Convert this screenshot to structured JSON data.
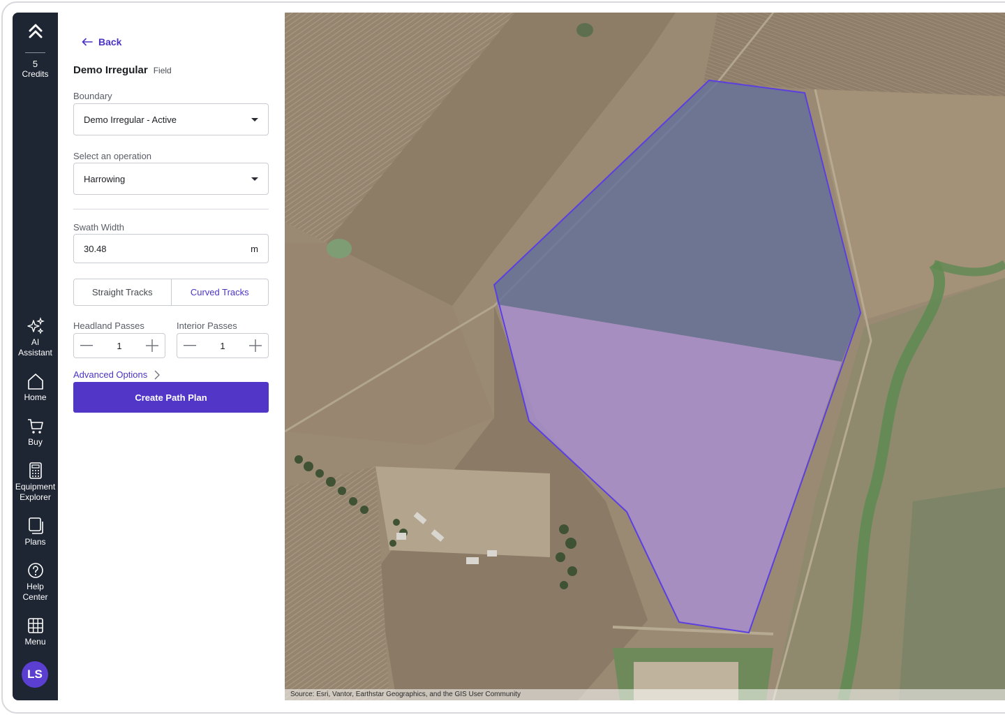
{
  "sidebar": {
    "credits_count": "5",
    "credits_label": "Credits",
    "items": [
      {
        "label": "AI\nAssistant",
        "icon": "sparkles-icon"
      },
      {
        "label": "Home",
        "icon": "home-icon"
      },
      {
        "label": "Buy",
        "icon": "cart-icon"
      },
      {
        "label": "Equipment\nExplorer",
        "icon": "calculator-icon"
      },
      {
        "label": "Plans",
        "icon": "plans-icon"
      },
      {
        "label": "Help\nCenter",
        "icon": "help-icon"
      },
      {
        "label": "Menu",
        "icon": "grid-icon"
      }
    ],
    "avatar_initials": "LS"
  },
  "panel": {
    "back_label": "Back",
    "field_name": "Demo Irregular",
    "field_type": "Field",
    "boundary_label": "Boundary",
    "boundary_value": "Demo Irregular - Active",
    "operation_label": "Select an operation",
    "operation_value": "Harrowing",
    "swath_label": "Swath Width",
    "swath_value": "30.48",
    "swath_unit": "m",
    "track_options": [
      "Straight Tracks",
      "Curved Tracks"
    ],
    "selected_track": "Curved Tracks",
    "headland_label": "Headland Passes",
    "headland_value": "1",
    "interior_label": "Interior Passes",
    "interior_value": "1",
    "advanced_label": "Advanced Options",
    "create_label": "Create Path Plan"
  },
  "map": {
    "attribution": "Source: Esri, Vantor, Earthstar Geographics, and the GIS User Community",
    "boundary_color": "#5b3fe0",
    "fill_color": "#a98fd6"
  }
}
